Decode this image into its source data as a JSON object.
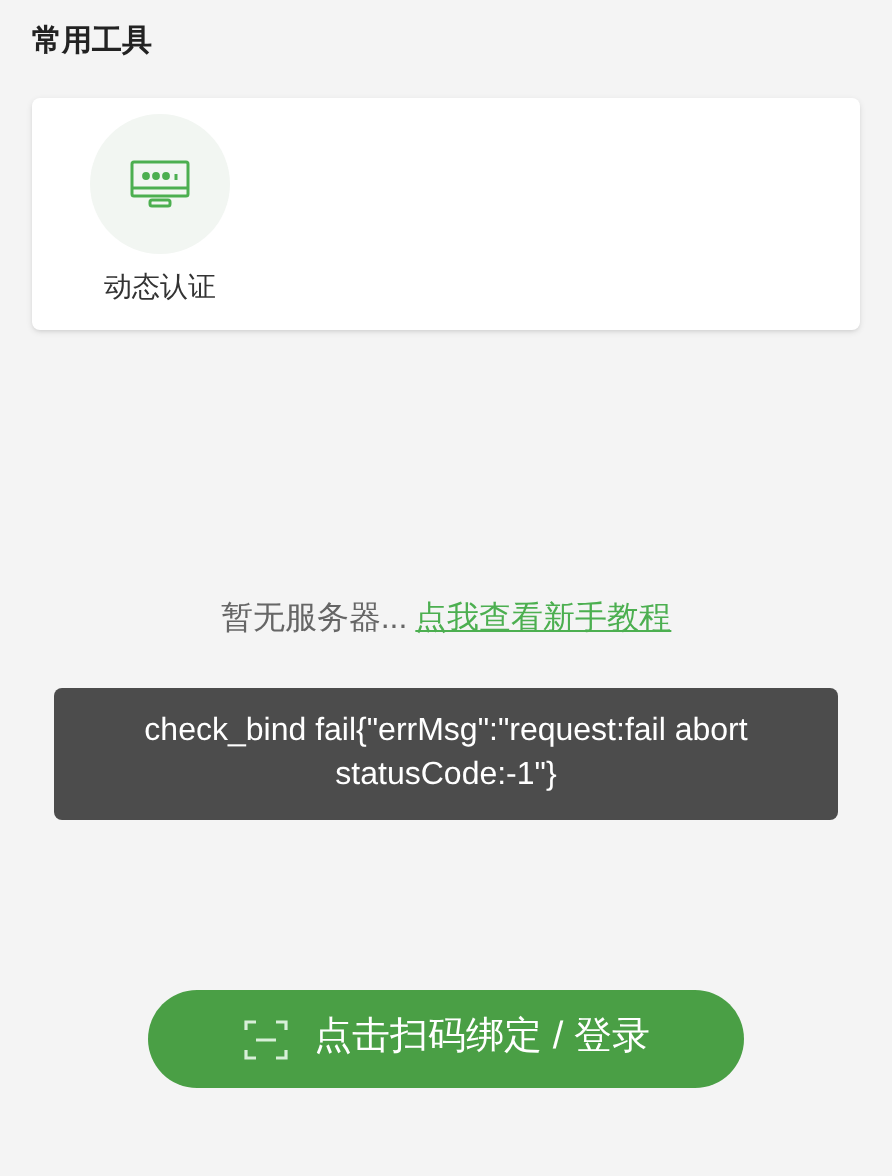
{
  "section_title": "常用工具",
  "tools": [
    {
      "label": "动态认证"
    }
  ],
  "empty_state": {
    "text": "暂无服务器...",
    "link": "点我查看新手教程"
  },
  "toast": {
    "text": "check_bind fail{\"errMsg\":\"request:fail abort statusCode:-1\"}"
  },
  "scan_button": {
    "label": "点击扫码绑定 / 登录"
  }
}
